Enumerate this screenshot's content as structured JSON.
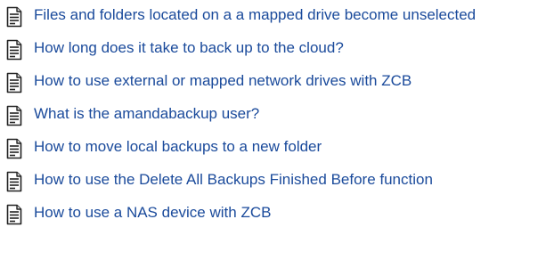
{
  "articles": [
    {
      "title": "Files and folders located on a a mapped drive become unselected",
      "icon": "document-icon"
    },
    {
      "title": "How long does it take to back up to the cloud?",
      "icon": "document-icon"
    },
    {
      "title": "How to use external or mapped network drives with ZCB",
      "icon": "document-icon"
    },
    {
      "title": "What is the amandabackup user?",
      "icon": "document-icon"
    },
    {
      "title": "How to move local backups to a new folder",
      "icon": "document-icon"
    },
    {
      "title": "How to use the Delete All Backups Finished Before function",
      "icon": "document-icon"
    },
    {
      "title": "How to use a NAS device with ZCB",
      "icon": "document-icon"
    }
  ],
  "colors": {
    "link": "#1a4a9b",
    "icon_stroke": "#222222"
  }
}
